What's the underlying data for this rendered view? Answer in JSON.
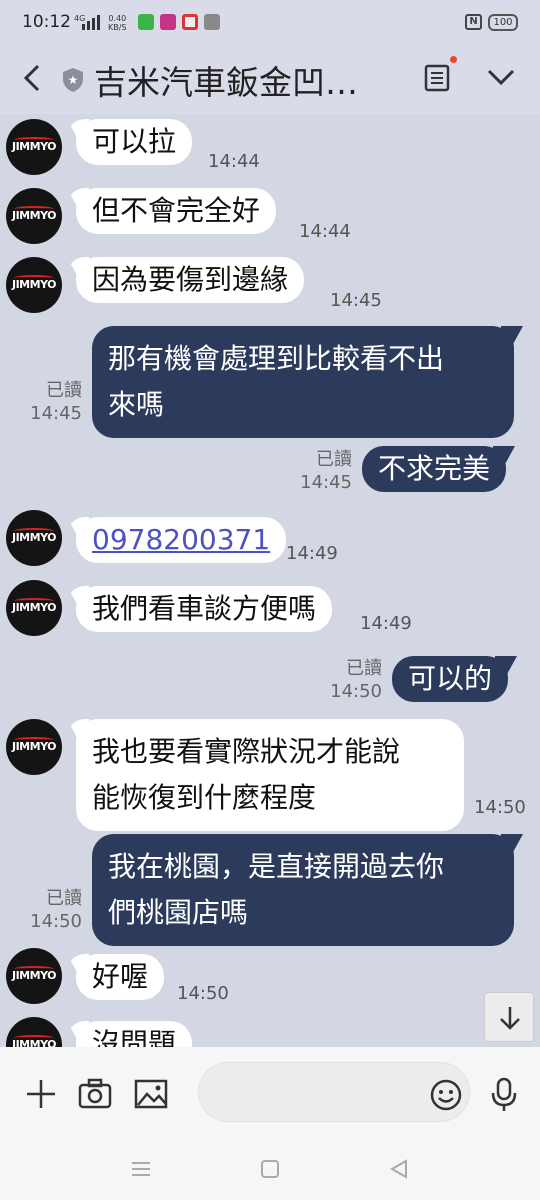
{
  "status_bar": {
    "time": "10:12",
    "network": "4G",
    "net_speed": "0.40",
    "net_speed_unit": "KB/S",
    "battery": "100",
    "nfc_label": "N"
  },
  "header": {
    "title": "吉米汽車鈑金凹…"
  },
  "avatar_text": "JIMMYO",
  "messages": [
    {
      "dir": "in",
      "text": "可以拉",
      "time": "14:44"
    },
    {
      "dir": "in",
      "text": "但不會完全好",
      "time": "14:44"
    },
    {
      "dir": "in",
      "text": "因為要傷到邊緣",
      "time": "14:45"
    },
    {
      "dir": "out",
      "lines": [
        "那有機會處理到比較看不出",
        "來嗎"
      ],
      "read": "已讀",
      "time": "14:45"
    },
    {
      "dir": "out",
      "text": "不求完美",
      "read": "已讀",
      "time": "14:45"
    },
    {
      "dir": "in",
      "text": "0978200371",
      "time": "14:49"
    },
    {
      "dir": "in",
      "text": "我們看車談方便嗎",
      "time": "14:49"
    },
    {
      "dir": "out",
      "text": "可以的",
      "read": "已讀",
      "time": "14:50"
    },
    {
      "dir": "in",
      "lines": [
        "我也要看實際狀況才能說",
        "能恢復到什麼程度"
      ],
      "time": "14:50"
    },
    {
      "dir": "out",
      "lines": [
        "我在桃園，是直接開過去你",
        "們桃園店嗎"
      ],
      "read": "已讀",
      "time": "14:50"
    },
    {
      "dir": "in",
      "text": "好喔",
      "time": "14:50"
    },
    {
      "dir": "in",
      "text": "沒問題",
      "time": ""
    }
  ],
  "colors": {
    "background": "#d3d7e3",
    "incoming_bubble": "#ffffff",
    "outgoing_bubble": "#2c3a5c",
    "link": "#4a52c4"
  },
  "icons": [
    "back-arrow-icon",
    "shield-icon",
    "notes-icon",
    "chevron-down-icon",
    "plus-icon",
    "camera-icon",
    "image-icon",
    "emoji-icon",
    "mic-icon",
    "scroll-down-icon",
    "nav-menu-icon",
    "nav-home-icon",
    "nav-back-icon"
  ]
}
